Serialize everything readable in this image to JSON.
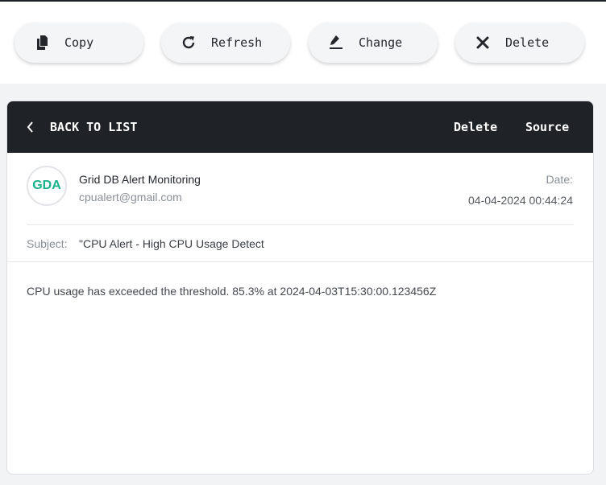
{
  "toolbar": {
    "buttons": [
      {
        "label": "Copy",
        "icon": "copy-icon"
      },
      {
        "label": "Refresh",
        "icon": "refresh-icon"
      },
      {
        "label": "Change",
        "icon": "edit-pen-icon"
      },
      {
        "label": "Delete",
        "icon": "close-x-icon"
      }
    ]
  },
  "header": {
    "back_label": "BACK TO LIST",
    "delete_label": "Delete",
    "source_label": "Source"
  },
  "message": {
    "avatar_initials": "GDA",
    "sender_name": "Grid DB Alert Monitoring",
    "sender_email": "cpualert@gmail.com",
    "date_label": "Date:",
    "date_value": "04-04-2024 00:44:24",
    "subject_label": "Subject:",
    "subject_value": "\"CPU Alert - High CPU Usage Detect",
    "body": "CPU usage has exceeded the threshold. 85.3% at 2024-04-03T15:30:00.123456Z"
  },
  "colors": {
    "header_bg": "#1f2227",
    "avatar_accent": "#19b28b",
    "page_bg": "#f2f3f5"
  }
}
